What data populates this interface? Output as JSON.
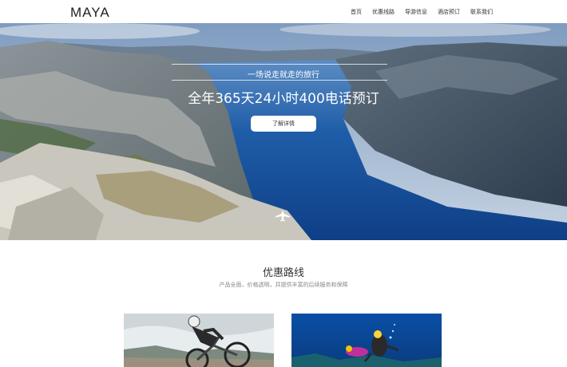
{
  "header": {
    "logo": "MAYA",
    "nav": [
      {
        "label": "首页"
      },
      {
        "label": "优惠线路"
      },
      {
        "label": "导游信息"
      },
      {
        "label": "酒店预订"
      },
      {
        "label": "联系我们"
      }
    ]
  },
  "hero": {
    "subtitle": "一场说走就走的旅行",
    "title": "全年365天24小时400电话预订",
    "button_label": "了解详情",
    "plane_icon": "plane-icon"
  },
  "section": {
    "title": "优惠路线",
    "subtitle": "产品全面，价格透明，并提供丰富的后续服务和保障"
  },
  "cards": [
    {
      "image": "cyclist-photo"
    },
    {
      "image": "diver-photo"
    }
  ],
  "colors": {
    "sky": "#9db4cf",
    "water": "#1f5da8",
    "rock": "#c9c6bd"
  }
}
